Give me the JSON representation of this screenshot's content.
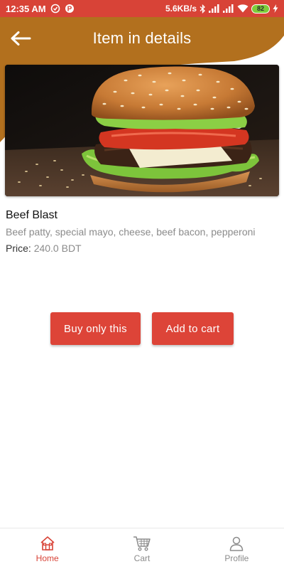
{
  "status_bar": {
    "time": "12:35 AM",
    "network_speed": "5.6KB/s",
    "battery": "82"
  },
  "header": {
    "title": "Item in details"
  },
  "item": {
    "name": "Beef Blast",
    "description": "Beef patty, special mayo, cheese, beef bacon, pepperoni",
    "price_label": "Price:",
    "price_value": "240.0 BDT"
  },
  "actions": {
    "buy_label": "Buy only this",
    "cart_label": "Add to cart"
  },
  "bottom_nav": {
    "items": [
      {
        "label": "Home",
        "icon": "home-icon",
        "active": true
      },
      {
        "label": "Cart",
        "icon": "cart-icon",
        "active": false
      },
      {
        "label": "Profile",
        "icon": "profile-icon",
        "active": false
      }
    ]
  },
  "colors": {
    "status_bar": "#d84337",
    "header_brown": "#b2701e",
    "accent_red": "#dd4438"
  }
}
